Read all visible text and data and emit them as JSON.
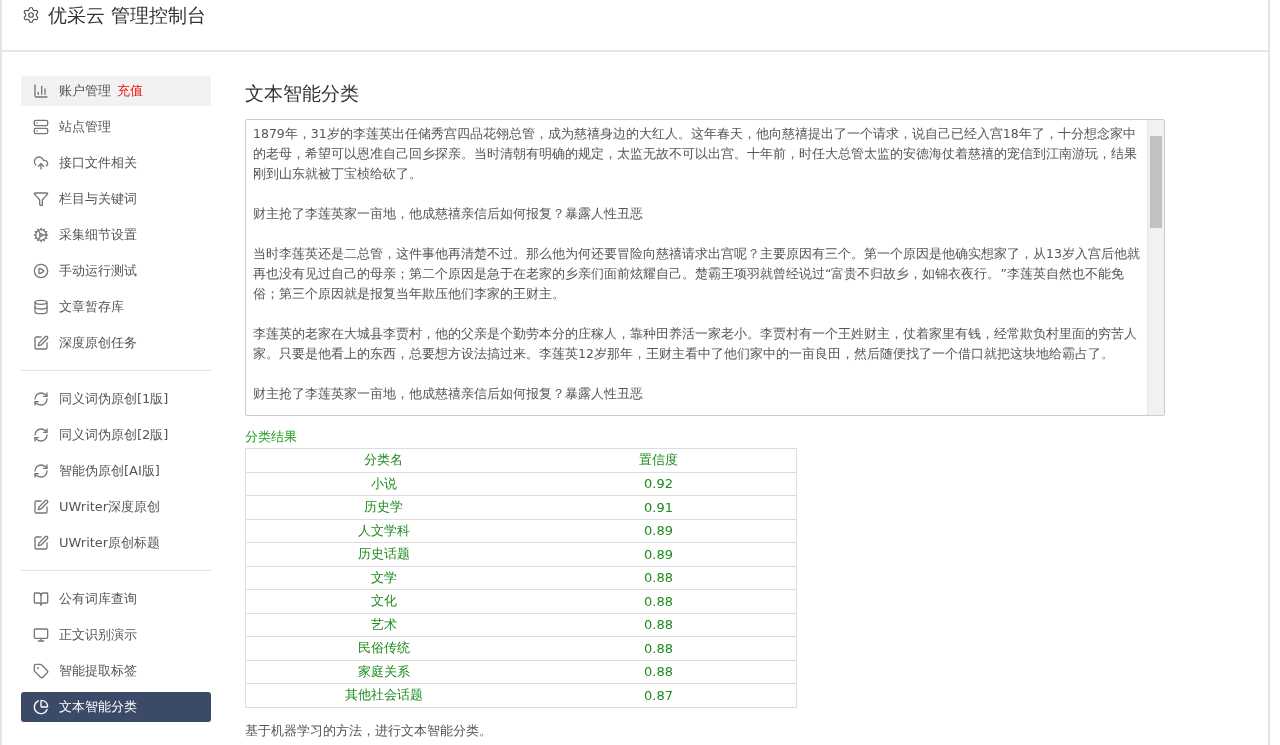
{
  "header": {
    "title": "优采云 管理控制台"
  },
  "sidebar": {
    "groups": [
      {
        "items": [
          {
            "label": "账户管理",
            "badge": "充值",
            "highlighted": true,
            "selected": false
          },
          {
            "label": "站点管理",
            "highlighted": false,
            "selected": false
          },
          {
            "label": "接口文件相关",
            "highlighted": false,
            "selected": false
          },
          {
            "label": "栏目与关键词",
            "highlighted": false,
            "selected": false
          },
          {
            "label": "采集细节设置",
            "highlighted": false,
            "selected": false
          },
          {
            "label": "手动运行测试",
            "highlighted": false,
            "selected": false
          },
          {
            "label": "文章暂存库",
            "highlighted": false,
            "selected": false
          },
          {
            "label": "深度原创任务",
            "highlighted": false,
            "selected": false
          }
        ]
      },
      {
        "items": [
          {
            "label": "同义词伪原创[1版]",
            "highlighted": false,
            "selected": false
          },
          {
            "label": "同义词伪原创[2版]",
            "highlighted": false,
            "selected": false
          },
          {
            "label": "智能伪原创[AI版]",
            "highlighted": false,
            "selected": false
          },
          {
            "label": "UWriter深度原创",
            "highlighted": false,
            "selected": false
          },
          {
            "label": "UWriter原创标题",
            "highlighted": false,
            "selected": false
          }
        ]
      },
      {
        "items": [
          {
            "label": "公有词库查询",
            "highlighted": false,
            "selected": false
          },
          {
            "label": "正文识别演示",
            "highlighted": false,
            "selected": false
          },
          {
            "label": "智能提取标签",
            "highlighted": false,
            "selected": false
          },
          {
            "label": "文本智能分类",
            "highlighted": false,
            "selected": true
          }
        ]
      }
    ]
  },
  "main": {
    "title": "文本智能分类",
    "text_area": {
      "paragraphs": [
        "1879年，31岁的李莲英出任储秀宫四品花翎总管，成为慈禧身边的大红人。这年春天，他向慈禧提出了一个请求，说自己已经入宫18年了，十分想念家中的老母，希望可以恩准自己回乡探亲。当时清朝有明确的规定，太监无故不可以出宫。十年前，时任大总管太监的安德海仗着慈禧的宠信到江南游玩，结果刚到山东就被丁宝桢给砍了。",
        "财主抢了李莲英家一亩地，他成慈禧亲信后如何报复？暴露人性丑恶",
        "当时李莲英还是二总管，这件事他再清楚不过。那么他为何还要冒险向慈禧请求出宫呢？主要原因有三个。第一个原因是他确实想家了，从13岁入宫后他就再也没有见过自己的母亲；第二个原因是急于在老家的乡亲们面前炫耀自己。楚霸王项羽就曾经说过“富贵不归故乡，如锦衣夜行。”李莲英自然也不能免俗；第三个原因就是报复当年欺压他们李家的王财主。",
        "李莲英的老家在大城县李贾村，他的父亲是个勤劳本分的庄稼人，靠种田养活一家老小。李贾村有一个王姓财主，仗着家里有钱，经常欺负村里面的穷苦人家。只要是他看上的东西，总要想方设法搞过来。李莲英12岁那年，王财主看中了他们家中的一亩良田，然后随便找了一个借口就把这块地给霸占了。",
        "财主抢了李莲英家一亩地，他成慈禧亲信后如何报复？暴露人性丑恶"
      ]
    },
    "result_label": "分类结果",
    "table": {
      "columns": [
        "分类名",
        "置信度"
      ],
      "rows": [
        [
          "小说",
          "0.92"
        ],
        [
          "历史学",
          "0.91"
        ],
        [
          "人文学科",
          "0.89"
        ],
        [
          "历史话题",
          "0.89"
        ],
        [
          "文学",
          "0.88"
        ],
        [
          "文化",
          "0.88"
        ],
        [
          "艺术",
          "0.88"
        ],
        [
          "民俗传统",
          "0.88"
        ],
        [
          "家庭关系",
          "0.88"
        ],
        [
          "其他社会话题",
          "0.87"
        ]
      ]
    },
    "note": "基于机器学习的方法，进行文本智能分类。"
  }
}
